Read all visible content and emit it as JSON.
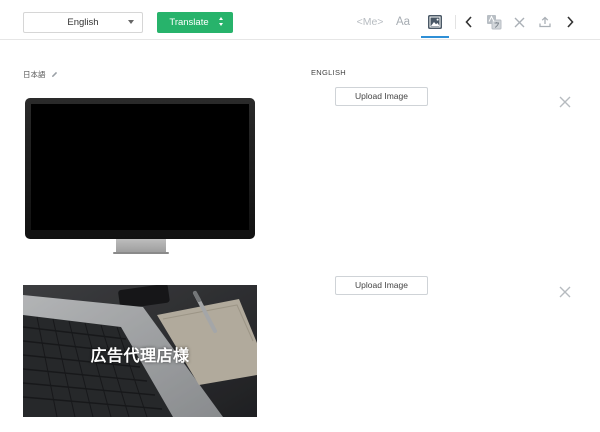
{
  "toolbar": {
    "language": "English",
    "translate_label": "Translate",
    "me_tag": "<Me>",
    "aa_label": "Aa"
  },
  "columns": {
    "source_label": "日本語",
    "target_label": "ENGLISH"
  },
  "rows": [
    {
      "upload_label": "Upload Image"
    },
    {
      "upload_label": "Upload Image",
      "image_caption": "広告代理店様"
    }
  ],
  "colors": {
    "accent_green": "#27b36b",
    "active_blue": "#2e8fd6"
  }
}
